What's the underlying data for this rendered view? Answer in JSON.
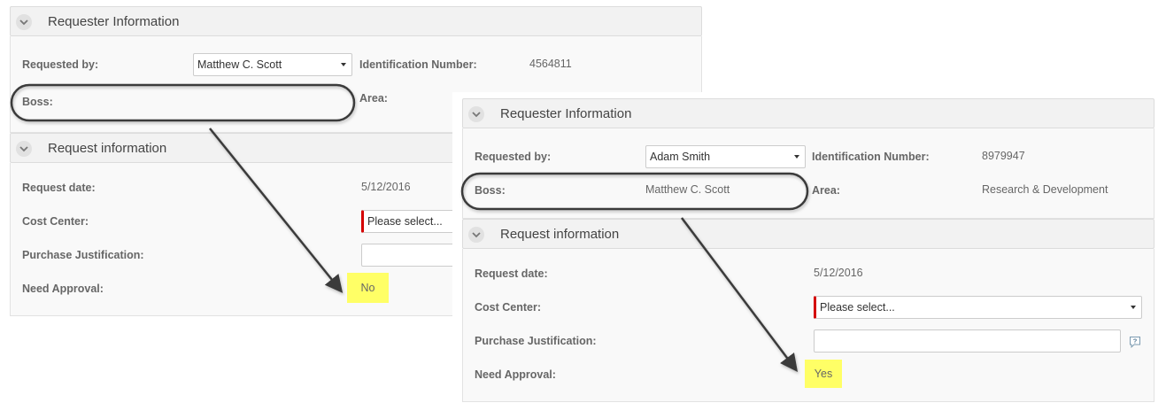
{
  "before": {
    "requester_section": {
      "title": "Requester Information",
      "requested_by_label": "Requested by:",
      "requested_by_value": "Matthew C. Scott",
      "id_label": "Identification Number:",
      "id_value": "4564811",
      "boss_label": "Boss:",
      "boss_value": "",
      "area_label": "Area:",
      "area_value": ""
    },
    "request_section": {
      "title": "Request information",
      "date_label": "Request date:",
      "date_value": "5/12/2016",
      "cost_center_label": "Cost Center:",
      "cost_center_placeholder": "Please select...",
      "justification_label": "Purchase Justification:",
      "approval_label": "Need Approval:",
      "approval_value": "No"
    }
  },
  "after": {
    "requester_section": {
      "title": "Requester Information",
      "requested_by_label": "Requested by:",
      "requested_by_value": "Adam Smith",
      "id_label": "Identification Number:",
      "id_value": "8979947",
      "boss_label": "Boss:",
      "boss_value": "Matthew C. Scott",
      "area_label": "Area:",
      "area_value": "Research & Development"
    },
    "request_section": {
      "title": "Request information",
      "date_label": "Request date:",
      "date_value": "5/12/2016",
      "cost_center_label": "Cost Center:",
      "cost_center_placeholder": "Please select...",
      "justification_label": "Purchase Justification:",
      "approval_label": "Need Approval:",
      "approval_value": "Yes"
    }
  },
  "colors": {
    "highlight": "#ffff66",
    "required_marker": "#d40000",
    "annotation": "#3a3a3a"
  },
  "icons": [
    "chevron-down-icon",
    "dropdown-caret-icon",
    "help-icon"
  ]
}
